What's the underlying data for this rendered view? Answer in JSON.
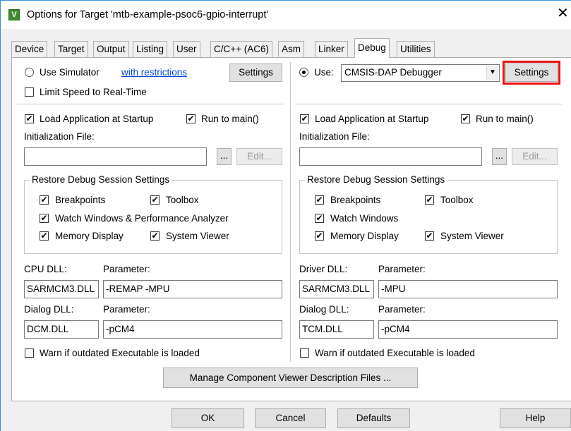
{
  "window": {
    "title": "Options for Target 'mtb-example-psoc6-gpio-interrupt'",
    "icon": "keil-uvision-icon",
    "close_glyph": "✕"
  },
  "tabs": [
    "Device",
    "Target",
    "Output",
    "Listing",
    "User",
    "C/C++ (AC6)",
    "Asm",
    "Linker",
    "Debug",
    "Utilities"
  ],
  "active_tab": "Debug",
  "left": {
    "use_simulator": "Use Simulator",
    "with_restrictions": "with restrictions",
    "settings": "Settings",
    "limit_speed": "Limit Speed to Real-Time",
    "load_app": "Load Application at Startup",
    "run_to_main": "Run to main()",
    "init_file": "Initialization File:",
    "browse": "...",
    "edit": "Edit...",
    "restore_title": "Restore Debug Session Settings",
    "breakpoints": "Breakpoints",
    "toolbox": "Toolbox",
    "watch_windows": "Watch Windows & Performance Analyzer",
    "memory_display": "Memory Display",
    "system_viewer": "System Viewer",
    "dll_label": "CPU DLL:",
    "parameter": "Parameter:",
    "dll_value": "SARMCM3.DLL",
    "dll_param": "-REMAP -MPU",
    "dialog_dll": "Dialog DLL:",
    "dialog_value": "DCM.DLL",
    "dialog_param": "-pCM4",
    "warn": "Warn if outdated Executable is loaded"
  },
  "right": {
    "use": "Use:",
    "debugger": "CMSIS-DAP Debugger",
    "settings": "Settings",
    "load_app": "Load Application at Startup",
    "run_to_main": "Run to main()",
    "init_file": "Initialization File:",
    "browse": "...",
    "edit": "Edit...",
    "restore_title": "Restore Debug Session Settings",
    "breakpoints": "Breakpoints",
    "toolbox": "Toolbox",
    "watch_windows": "Watch Windows",
    "memory_display": "Memory Display",
    "system_viewer": "System Viewer",
    "dll_label": "Driver DLL:",
    "parameter": "Parameter:",
    "dll_value": "SARMCM3.DLL",
    "dll_param": "-MPU",
    "dialog_dll": "Dialog DLL:",
    "dialog_value": "TCM.DLL",
    "dialog_param": "-pCM4",
    "warn": "Warn if outdated Executable is loaded"
  },
  "manage_button": "Manage Component Viewer Description Files ...",
  "footer": {
    "ok": "OK",
    "cancel": "Cancel",
    "defaults": "Defaults",
    "help": "Help"
  },
  "check": "✔",
  "colors": {
    "highlight": "#e81414",
    "link": "#0645d8"
  }
}
